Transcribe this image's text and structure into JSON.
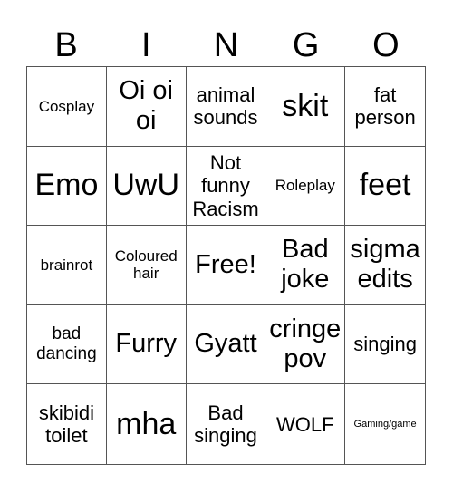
{
  "title_letters": [
    "B",
    "I",
    "N",
    "G",
    "O"
  ],
  "cells": [
    "Cosplay",
    "Oi oi oi",
    "animal sounds",
    "skit",
    "fat person",
    "Emo",
    "UwU",
    "Not funny Racism",
    "Roleplay",
    "feet",
    "brainrot",
    "Coloured hair",
    "Free!",
    "Bad joke",
    "sigma edits",
    "bad dancing",
    "Furry",
    "Gyatt",
    "cringe pov",
    "singing",
    "skibidi toilet",
    "mha",
    "Bad singing",
    "WOLF",
    "Gaming/game"
  ]
}
